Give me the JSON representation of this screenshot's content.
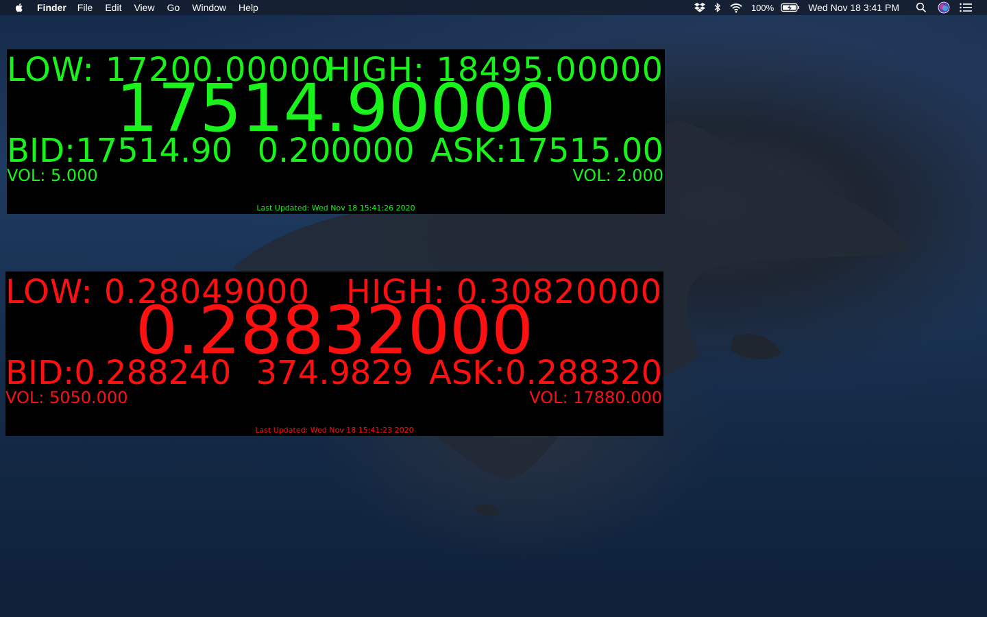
{
  "menubar": {
    "app_name": "Finder",
    "menus": [
      "File",
      "Edit",
      "View",
      "Go",
      "Window",
      "Help"
    ],
    "battery": "100%",
    "clock": "Wed Nov 18  3:41 PM",
    "icons": [
      "apple-icon",
      "dropbox-icon",
      "bluetooth-icon",
      "wifi-icon",
      "battery-icon",
      "spotlight-icon",
      "siri-icon",
      "notification-center-icon"
    ]
  },
  "colors": {
    "panel1_text": "#19f31b",
    "panel2_text": "#ff1010",
    "panel_bg": "#000000"
  },
  "tickers": [
    {
      "low": "LOW: 17200.00000",
      "high": "HIGH: 18495.00000",
      "price": "17514.90000",
      "bid": "BID:17514.90",
      "change": "0.200000",
      "ask": "ASK:17515.00",
      "bid_vol": "VOL: 5.000",
      "ask_vol": "VOL: 2.000",
      "last_updated": "Last Updated: Wed Nov 18 15:41:26 2020"
    },
    {
      "low": "LOW: 0.28049000",
      "high": "HIGH: 0.30820000",
      "price": "0.28832000",
      "bid": "BID:0.288240",
      "change": "374.9829",
      "ask": "ASK:0.288320",
      "bid_vol": "VOL: 5050.000",
      "ask_vol": "VOL: 17880.000",
      "last_updated": "Last Updated: Wed Nov 18 15:41:23 2020"
    }
  ]
}
